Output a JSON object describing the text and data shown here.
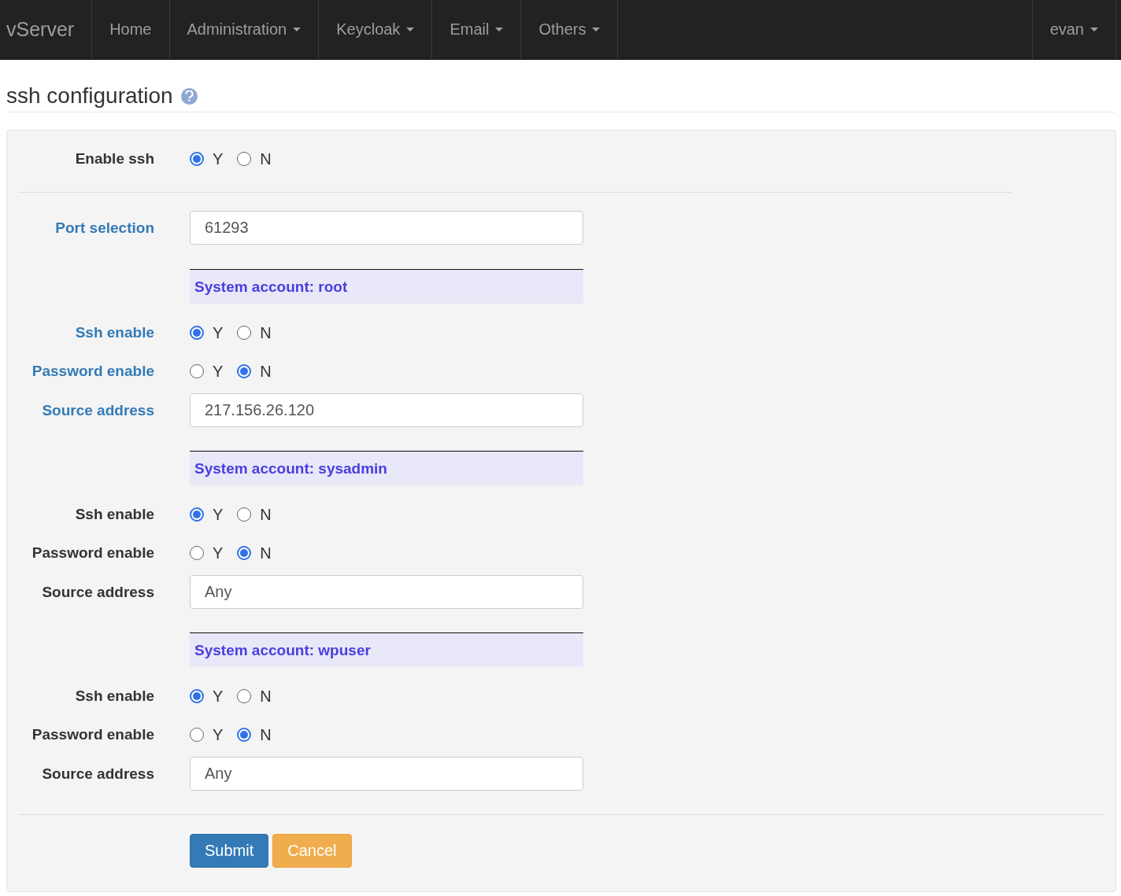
{
  "navbar": {
    "brand": "vServer",
    "items": [
      {
        "label": "Home",
        "dropdown": false
      },
      {
        "label": "Administration",
        "dropdown": true
      },
      {
        "label": "Keycloak",
        "dropdown": true
      },
      {
        "label": "Email",
        "dropdown": true
      },
      {
        "label": "Others",
        "dropdown": true
      }
    ],
    "user": {
      "label": "evan",
      "dropdown": true
    }
  },
  "page": {
    "title": "ssh configuration"
  },
  "form": {
    "enable_ssh": {
      "label": "Enable ssh",
      "highlighted": false,
      "options": [
        {
          "label": "Y",
          "selected": true
        },
        {
          "label": "N",
          "selected": false
        }
      ]
    },
    "port": {
      "label": "Port selection",
      "value": "61293",
      "highlighted": true
    },
    "accounts": [
      {
        "header": "System account: root",
        "fields": [
          {
            "kind": "radio",
            "label": "Ssh enable",
            "highlighted": true,
            "options": [
              {
                "label": "Y",
                "selected": true
              },
              {
                "label": "N",
                "selected": false
              }
            ]
          },
          {
            "kind": "radio",
            "label": "Password enable",
            "highlighted": true,
            "options": [
              {
                "label": "Y",
                "selected": false
              },
              {
                "label": "N",
                "selected": true
              }
            ]
          },
          {
            "kind": "input",
            "label": "Source address",
            "highlighted": true,
            "value": "217.156.26.120"
          }
        ]
      },
      {
        "header": "System account: sysadmin",
        "fields": [
          {
            "kind": "radio",
            "label": "Ssh enable",
            "highlighted": false,
            "options": [
              {
                "label": "Y",
                "selected": true
              },
              {
                "label": "N",
                "selected": false
              }
            ]
          },
          {
            "kind": "radio",
            "label": "Password enable",
            "highlighted": false,
            "options": [
              {
                "label": "Y",
                "selected": false
              },
              {
                "label": "N",
                "selected": true
              }
            ]
          },
          {
            "kind": "input",
            "label": "Source address",
            "highlighted": false,
            "value": "Any"
          }
        ]
      },
      {
        "header": "System account: wpuser",
        "fields": [
          {
            "kind": "radio",
            "label": "Ssh enable",
            "highlighted": false,
            "options": [
              {
                "label": "Y",
                "selected": true
              },
              {
                "label": "N",
                "selected": false
              }
            ]
          },
          {
            "kind": "radio",
            "label": "Password enable",
            "highlighted": false,
            "options": [
              {
                "label": "Y",
                "selected": false
              },
              {
                "label": "N",
                "selected": true
              }
            ]
          },
          {
            "kind": "input",
            "label": "Source address",
            "highlighted": false,
            "value": "Any"
          }
        ]
      }
    ],
    "buttons": [
      {
        "label": "Submit",
        "kind": "primary"
      },
      {
        "label": "Cancel",
        "kind": "warning"
      }
    ]
  }
}
